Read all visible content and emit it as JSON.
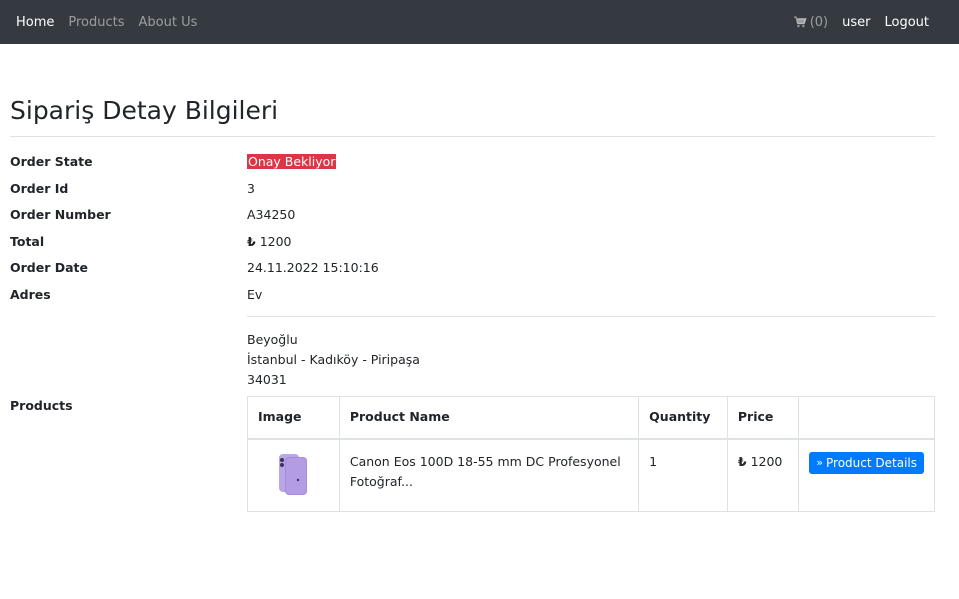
{
  "nav": {
    "home": "Home",
    "products": "Products",
    "about": "About Us",
    "cart": "(0)",
    "user": "user",
    "logout": "Logout"
  },
  "page": {
    "title": "Sipariş Detay Bilgileri"
  },
  "order": {
    "state_label": "Order State",
    "state": "Onay Bekliyor",
    "id_label": "Order Id",
    "id": "3",
    "number_label": "Order Number",
    "number": "A34250",
    "total_label": "Total",
    "currency": "₺",
    "total": "1200",
    "date_label": "Order Date",
    "date": "24.11.2022 15:10:16",
    "address_label": "Adres",
    "address_title": "Ev"
  },
  "address": {
    "line1": "Beyoğlu",
    "line2": "İstanbul - Kadıköy - Piripaşa",
    "line3": "34031"
  },
  "products": {
    "label": "Products",
    "headers": {
      "image": "Image",
      "name": "Product Name",
      "quantity": "Quantity",
      "price": "Price"
    },
    "rows": [
      {
        "name": "Canon Eos 100D 18-55 mm DC Profesyonel Fotoğraf...",
        "quantity": "1",
        "currency": "₺",
        "price": "1200",
        "button": "Product Details",
        "image_icon": "phone-product-image"
      }
    ]
  },
  "colors": {
    "navbar": "#343a40",
    "badge": "#dc3545",
    "button": "#007bff"
  }
}
